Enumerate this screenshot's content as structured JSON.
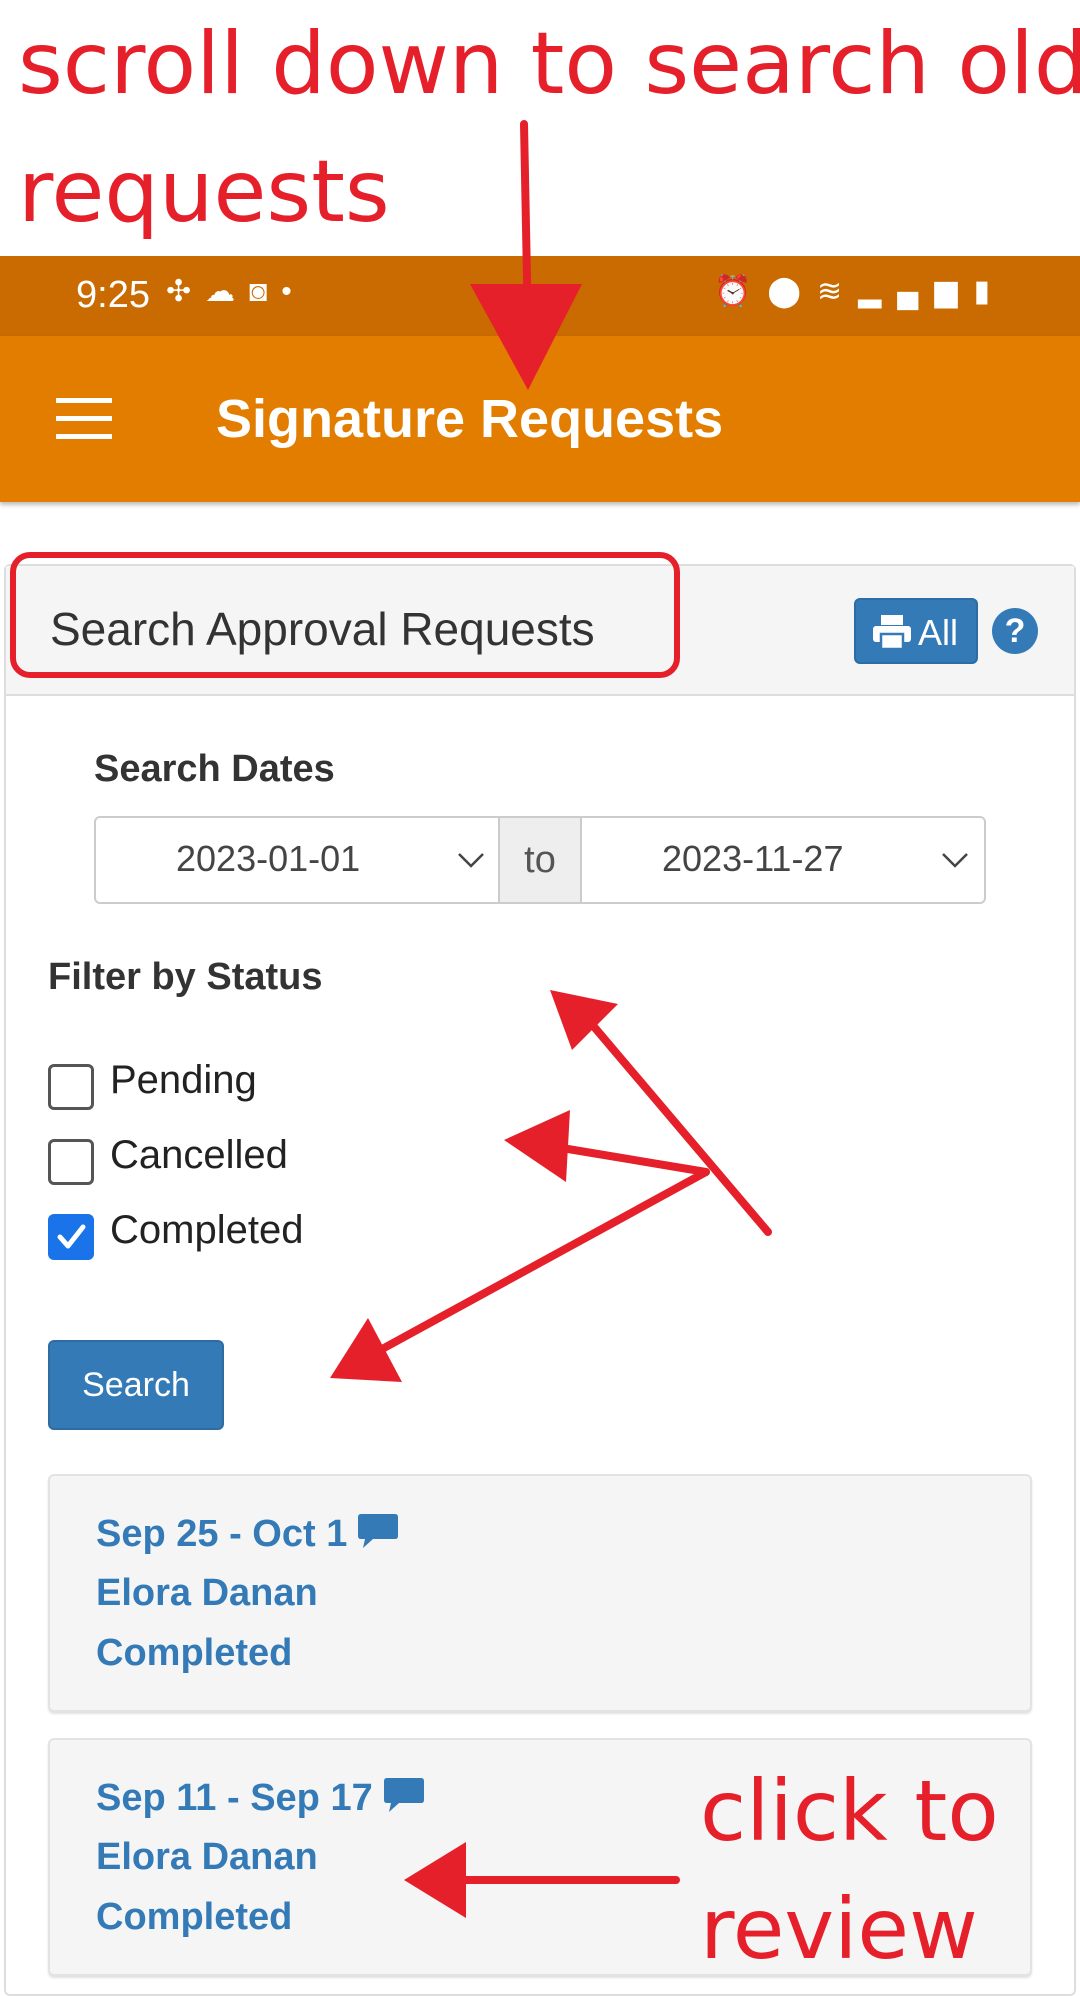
{
  "annotations": {
    "top_line1": "scroll down to search old",
    "top_line2": "requests",
    "click_line1": "click to",
    "click_line2": "review",
    "color": "#e5202a"
  },
  "status_bar": {
    "time": "9:25",
    "left_icons": [
      "slack-icon",
      "cloud-icon",
      "clock-app-icon",
      "dot-icon"
    ],
    "right_icons": [
      "alarm-icon",
      "location-icon",
      "wifi-icon",
      "signal-icon",
      "battery-icon"
    ]
  },
  "app_bar": {
    "title": "Signature Requests",
    "color": "#e27d00"
  },
  "panel": {
    "title": "Search Approval Requests",
    "print_all_label": "All",
    "help_label": "?"
  },
  "search_dates": {
    "label": "Search Dates",
    "from": "2023-01-01",
    "separator": "to",
    "to": "2023-11-27"
  },
  "filter": {
    "label": "Filter by Status",
    "options": [
      {
        "label": "Pending",
        "checked": false
      },
      {
        "label": "Cancelled",
        "checked": false
      },
      {
        "label": "Completed",
        "checked": true
      }
    ]
  },
  "search_button": "Search",
  "requests": [
    {
      "dates": "Sep 25 - Oct 1",
      "name": "Elora Danan",
      "status": "Completed"
    },
    {
      "dates": "Sep 11 - Sep 17",
      "name": "Elora Danan",
      "status": "Completed"
    }
  ],
  "accent": "#337ab7"
}
